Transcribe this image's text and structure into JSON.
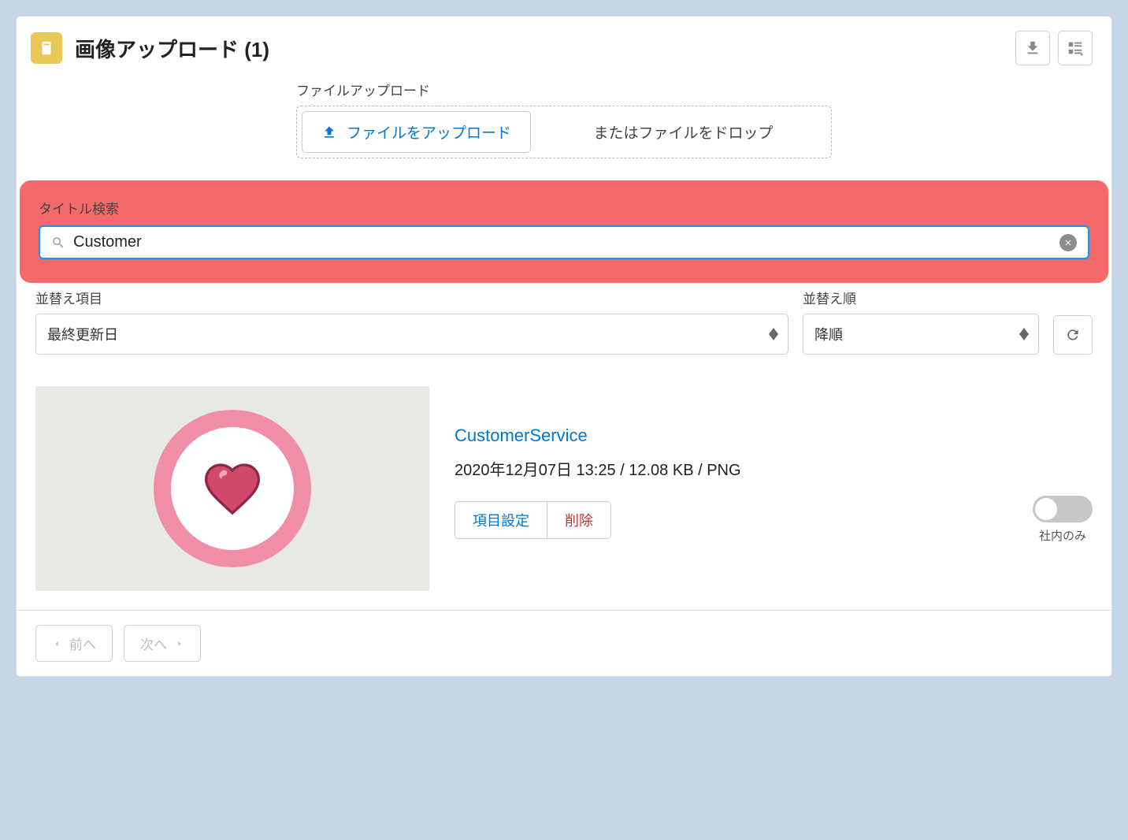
{
  "header": {
    "title": "画像アップロード (1)"
  },
  "upload": {
    "section_label": "ファイルアップロード",
    "button_label": "ファイルをアップロード",
    "drop_hint": "またはファイルをドロップ"
  },
  "search": {
    "label": "タイトル検索",
    "value": "Customer"
  },
  "sort": {
    "field_label": "並替え項目",
    "field_value": "最終更新日",
    "order_label": "並替え順",
    "order_value": "降順"
  },
  "result": {
    "title": "CustomerService",
    "meta": "2020年12月07日 13:25 / 12.08 KB / PNG",
    "settings_label": "項目設定",
    "delete_label": "削除",
    "toggle_label": "社内のみ"
  },
  "pager": {
    "prev_label": "前へ",
    "next_label": "次へ"
  }
}
